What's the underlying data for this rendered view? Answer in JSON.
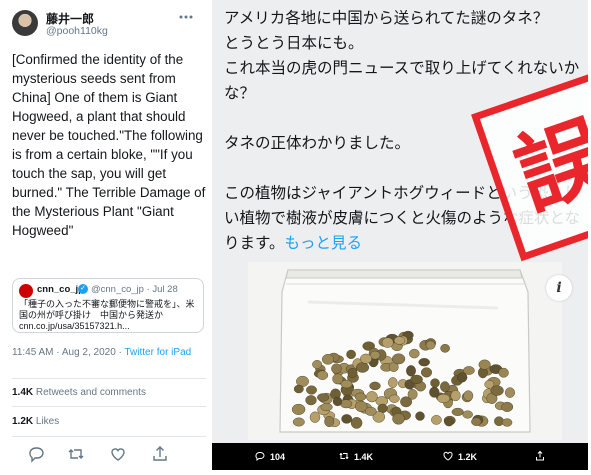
{
  "tweet": {
    "author_name": "藤井一郎",
    "author_handle": "@pooh110kg",
    "text": "[Confirmed the identity of the mysterious seeds sent from China] One of them is Giant Hogweed, a plant that should never be touched.\"The following is from a certain bloke, \"\"If you touch the sap, you will get burned.\" The Terrible Damage of the Mysterious Plant \"Giant Hogweed\"",
    "quote": {
      "name": "cnn_co_jp",
      "meta": "@cnn_co_jp · Jul 28",
      "body": "「種子の入った不審な郵便物に警戒を」、米国の州が呼び掛け　中国から発送か cnn.co.jp/usa/35157321.h..."
    },
    "timestamp": "11:45 AM · Aug 2, 2020 · ",
    "source": "Twitter for iPad",
    "retweets_count": "1.4K",
    "retweets_label": " Retweets and comments",
    "likes_count": "1.2K",
    "likes_label": " Likes"
  },
  "icons": {
    "more": "more-options-icon",
    "reply": "reply-icon",
    "retweet": "retweet-icon",
    "like": "like-icon",
    "share": "share-icon",
    "info": "info-icon",
    "verified": "verified-badge-icon",
    "stamp": "misleading-stamp"
  },
  "media": {
    "jp_text": "アメリカ各地に中国から送られてた謎のタネ？\nとうとう日本にも。\nこれ本当の虎の門ニュースで取り上げてくれないかな？\n\nタネの正体わかりました。\n\nこの植物はジャイアントホグウィードという恐ろしい植物で樹液が皮膚につくと火傷のような症状となります。",
    "jp_more": "もっと見る",
    "info_label": "i",
    "reply_count": "104",
    "retweet_count": "1.4K",
    "like_count": "1.2K"
  },
  "stamp": {
    "text": "誤導"
  },
  "colors": {
    "accent": "#1da1f2",
    "stamp_red": "#e8262b",
    "muted": "#657786",
    "media_bar": "#000000"
  }
}
